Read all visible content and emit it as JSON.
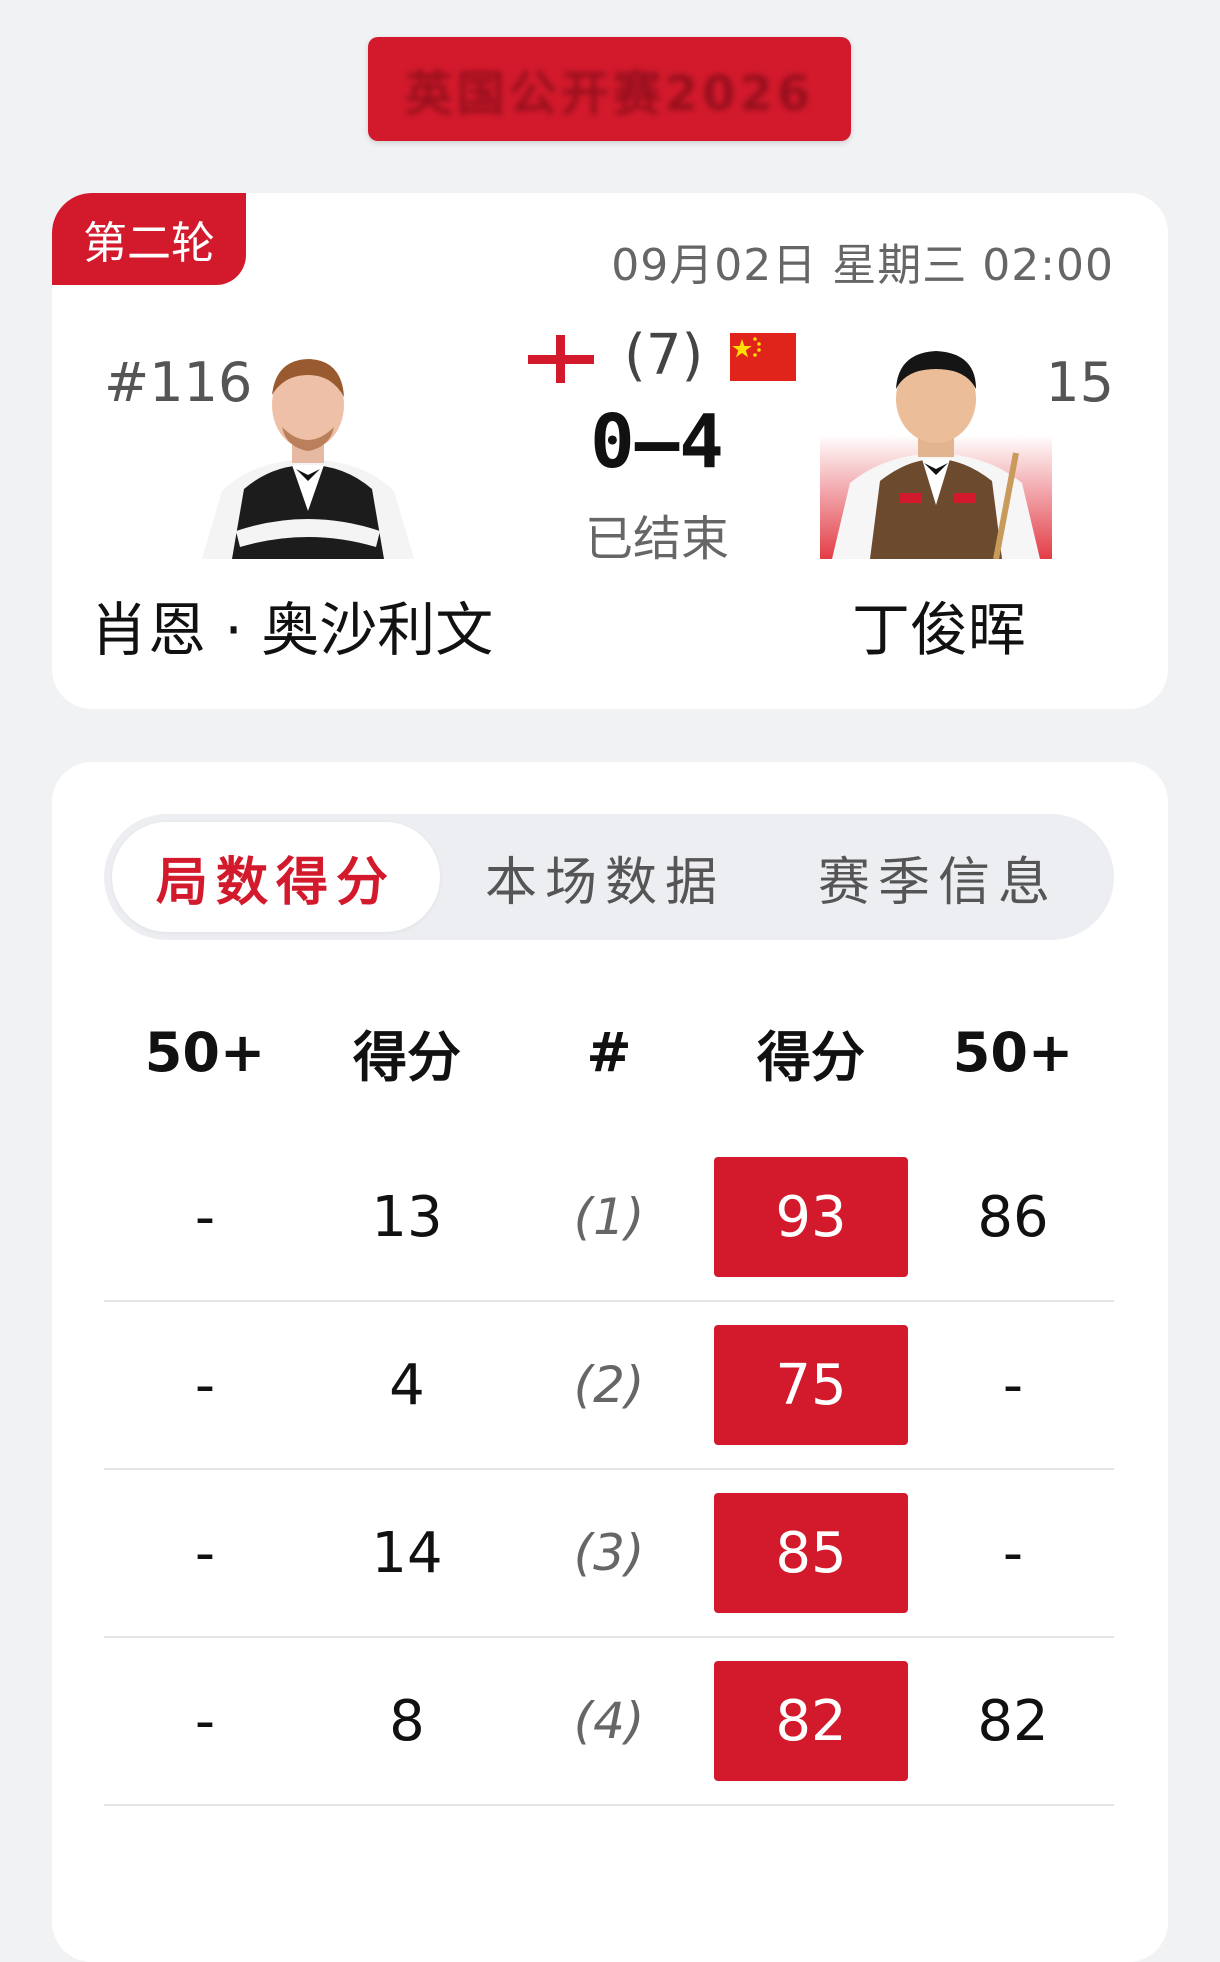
{
  "header": {
    "banner_text": "英国公开赛2026"
  },
  "match": {
    "round": "第二轮",
    "datetime": "09月02日 星期三 02:00",
    "frames_best": "(7)",
    "score": "0–4",
    "status": "已结束",
    "left_player": {
      "rank": "#116",
      "name": "肖恩 · 奥沙利文",
      "flag": "england-flag-icon"
    },
    "right_player": {
      "rank": "#15",
      "name": "丁俊晖",
      "flag": "china-flag-icon"
    }
  },
  "tabs": [
    {
      "label": "局数得分",
      "active": true
    },
    {
      "label": "本场数据",
      "active": false
    },
    {
      "label": "赛季信息",
      "active": false
    }
  ],
  "table": {
    "headers": [
      "50+",
      "得分",
      "#",
      "得分",
      "50+"
    ],
    "rows": [
      {
        "l50": "-",
        "lscore": "13",
        "frame": "(1)",
        "rscore": "93",
        "r50": "86"
      },
      {
        "l50": "-",
        "lscore": "4",
        "frame": "(2)",
        "rscore": "75",
        "r50": "-"
      },
      {
        "l50": "-",
        "lscore": "14",
        "frame": "(3)",
        "rscore": "85",
        "r50": "-"
      },
      {
        "l50": "-",
        "lscore": "8",
        "frame": "(4)",
        "rscore": "82",
        "r50": "82"
      }
    ]
  },
  "colors": {
    "accent": "#d21a2c",
    "background": "#f1f2f4"
  }
}
